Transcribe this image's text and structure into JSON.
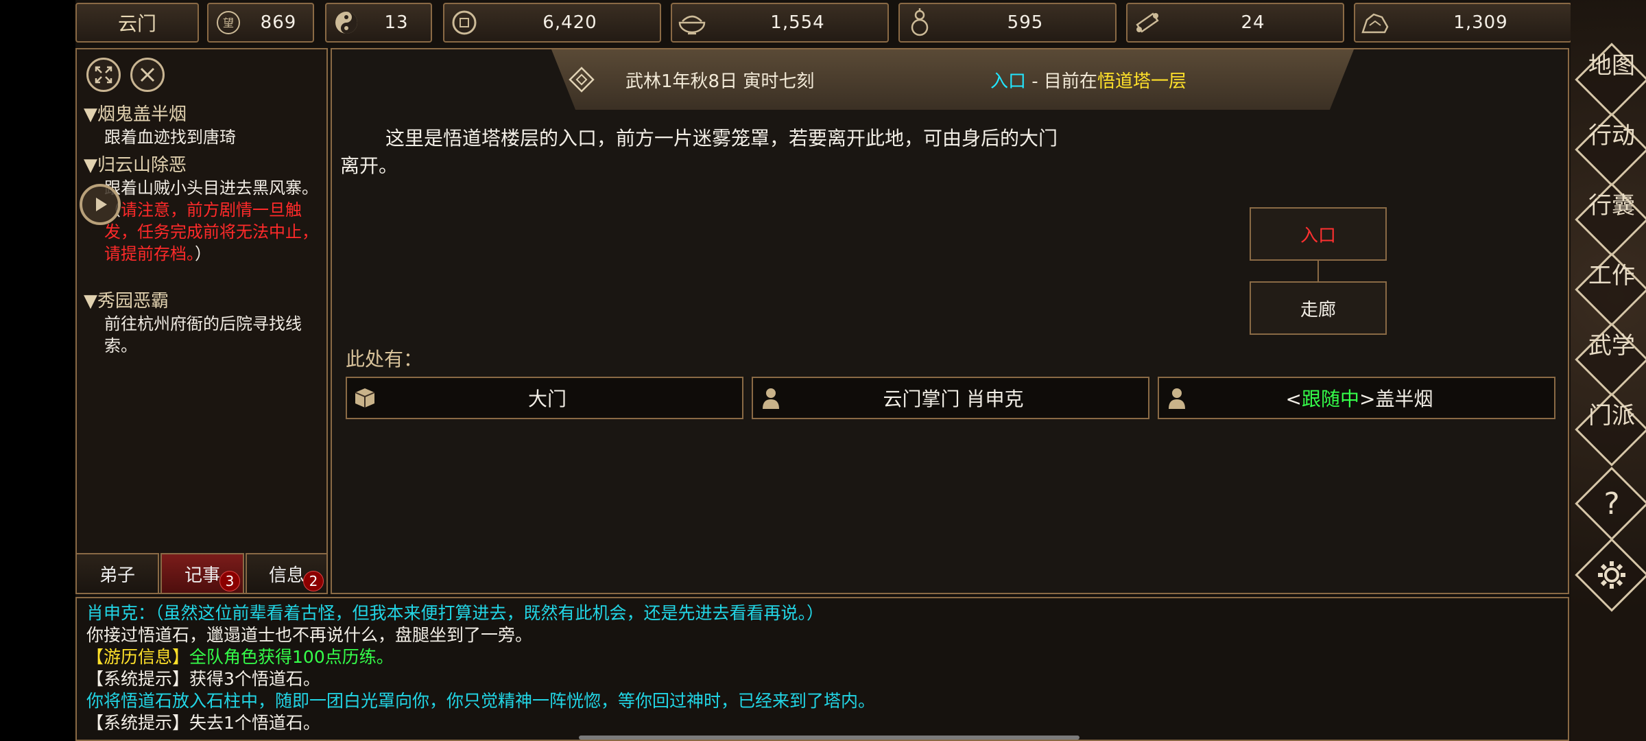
{
  "resources": [
    {
      "id": "sect",
      "icon": "sect-label",
      "value": "云门"
    },
    {
      "id": "reputation",
      "icon": "reputation-icon",
      "value": "869"
    },
    {
      "id": "morality",
      "icon": "yin-yang-icon",
      "value": "13"
    },
    {
      "id": "money",
      "icon": "coin-icon",
      "value": "6,420"
    },
    {
      "id": "food",
      "icon": "food-bowl-icon",
      "value": "1,554"
    },
    {
      "id": "medicine",
      "icon": "gourd-icon",
      "value": "595"
    },
    {
      "id": "scroll",
      "icon": "scroll-icon",
      "value": "24"
    },
    {
      "id": "ore",
      "icon": "ore-icon",
      "value": "1,309"
    }
  ],
  "quests": [
    {
      "title": "▼烟鬼盖半烟",
      "desc": "跟着血迹找到唐琦"
    },
    {
      "title": "▼归云山除恶",
      "desc_prefix": "跟着山贼小头目进去黑风寨。（",
      "desc_warning": "请注意，前方剧情一旦触发，任务完成前将无法中止，请提前存档。",
      "desc_suffix": "）"
    },
    {
      "title": "▼秀园恶霸",
      "desc": "前往杭州府衙的后院寻找线索。"
    }
  ],
  "tabs": [
    {
      "label": "弟子",
      "badge": ""
    },
    {
      "label": "记事",
      "badge": "3"
    },
    {
      "label": "信息",
      "badge": "2"
    }
  ],
  "header": {
    "date": "武林1年秋8日 寅时七刻",
    "room": "入口",
    "sep": " - 目前在",
    "place": "悟道塔一层"
  },
  "description": "这里是悟道塔楼层的入口，前方一片迷雾笼罩，若要离开此地，可由身后的大门离开。",
  "map": {
    "current": "入口",
    "next": "走廊"
  },
  "here_label": "此处有：",
  "objects": [
    {
      "icon": "box-icon",
      "label": "大门"
    },
    {
      "icon": "person-icon",
      "label": "云门掌门 肖申克"
    },
    {
      "icon": "person-icon",
      "pre": "<",
      "follow": "跟随中",
      "post": ">盖半烟"
    }
  ],
  "log": [
    {
      "text": "肖申克：（虽然这位前辈看着古怪，但我本来便打算进去，既然有此机会，还是先进去看看再说。）",
      "color": "#22d6e6"
    },
    {
      "text": "你接过悟道石，邋遢道士也不再说什么，盘腿坐到了一旁。",
      "color": "#f3efe7"
    },
    {
      "tag": "【游历信息】",
      "text": "全队角色获得100点历练。",
      "tagcolor": "#ffe12a",
      "color": "#35ff4a"
    },
    {
      "text": "【系统提示】获得3个悟道石。",
      "color": "#f3efe7"
    },
    {
      "text": "你将悟道石放入石柱中，随即一团白光罩向你，你只觉精神一阵恍惚，等你回过神时，已经来到了塔内。",
      "color": "#22d6e6"
    },
    {
      "text": "【系统提示】失去1个悟道石。",
      "color": "#f3efe7"
    }
  ],
  "side_menu": [
    {
      "id": "map",
      "label": "地图"
    },
    {
      "id": "action",
      "label": "行动"
    },
    {
      "id": "bag",
      "label": "行囊"
    },
    {
      "id": "work",
      "label": "工作"
    },
    {
      "id": "martial",
      "label": "武学"
    },
    {
      "id": "sect",
      "label": "门派"
    },
    {
      "id": "help",
      "label": "?"
    },
    {
      "id": "settings",
      "label": "settings"
    }
  ]
}
